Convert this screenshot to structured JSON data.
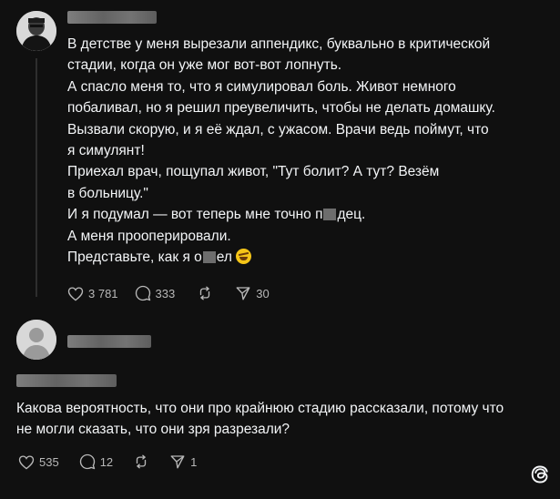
{
  "post": {
    "lines": [
      "В детстве у меня вырезали аппендикс, буквально в критической",
      "стадии, когда он уже мог вот-вот лопнуть.",
      "А спасло меня то, что я симулировал боль. Живот немного",
      "побаливал, но я решил преувеличить, чтобы не делать домашку.",
      "Вызвали скорую, и я её ждал, с ужасом. Врачи ведь поймут, что",
      "я симулянт!",
      "Приехал врач, пощупал живот, \"Тут болит? А тут? Везём",
      "в больницу.\"",
      "И я подумал — вот теперь мне точно п",
      "А меня прооперировали.",
      "Представьте, как я о"
    ],
    "line9_suffix": "дец.",
    "line11_suffix": "ел",
    "likes": "3 781",
    "comments": "333",
    "shares": "30"
  },
  "reply": {
    "lines": [
      "Какова вероятность, что они про крайнюю стадию рассказали, потому что",
      "не могли сказать, что они зря разрезали?"
    ],
    "likes": "535",
    "comments": "12",
    "shares": "1"
  },
  "icons": [
    "heart-icon",
    "comment-icon",
    "repost-icon",
    "share-icon",
    "threads-logo-icon"
  ]
}
